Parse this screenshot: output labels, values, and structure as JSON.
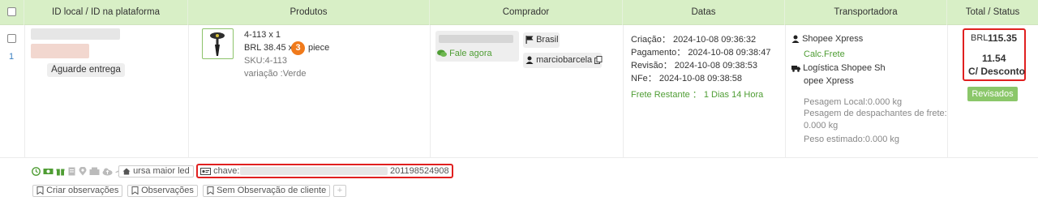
{
  "header": {
    "col_id": "ID local / ID na plataforma",
    "col_products": "Produtos",
    "col_buyer": "Comprador",
    "col_dates": "Datas",
    "col_carrier": "Transportadora",
    "col_total": "Total / Status"
  },
  "order": {
    "row_index": "1",
    "status_badge": "Aguarde entrega",
    "product": {
      "name": "4-113 x 1",
      "price_prefix": "BRL 38.45 x",
      "quantity": "3",
      "unit": "piece",
      "sku": "SKU:4-113",
      "variation": "variação :Verde"
    },
    "buyer": {
      "chat_label": "Fale agora",
      "country": "Brasil",
      "username": "marciobarcela"
    },
    "dates": {
      "criacao": "Criação： 2024-10-08 09:36:32",
      "pagamento": "Pagamento： 2024-10-08 09:38:47",
      "revisao": "Revisão： 2024-10-08 09:38:53",
      "nfe": "NFe： 2024-10-08 09:38:58",
      "frete_restante": "Frete Restante ： 1 Dias 14 Hora"
    },
    "carrier": {
      "name": "Shopee Xpress",
      "calc_link": "Calc.Frete",
      "logistics_line1": "Logística Shopee Sh",
      "logistics_line2": "opee Xpress",
      "peso_local": "Pesagem Local:0.000 kg",
      "peso_desp_line1": "Pesagem de despachantes de frete:",
      "peso_desp_line2": "0.000 kg",
      "peso_estimado": "Peso estimado:0.000 kg"
    },
    "total": {
      "currency": "BRL",
      "amount": "115.35",
      "discount_value": "11.54",
      "discount_label": "C/ Desconto",
      "status_button": "Revisados"
    },
    "footer": {
      "tag": "ursa maior led",
      "chave_label": "chave:",
      "chave_value": "201198524908",
      "btn_criar": "Criar observações",
      "btn_obs": "Observações",
      "btn_sem_obs": "Sem Observação de cliente",
      "btn_add": "+"
    }
  },
  "colors": {
    "header_bg": "#d8efc6",
    "accent_green": "#4f9d34",
    "button_green": "#8bc76a",
    "highlight_red": "#e02020",
    "qty_orange": "#f07a1b"
  }
}
